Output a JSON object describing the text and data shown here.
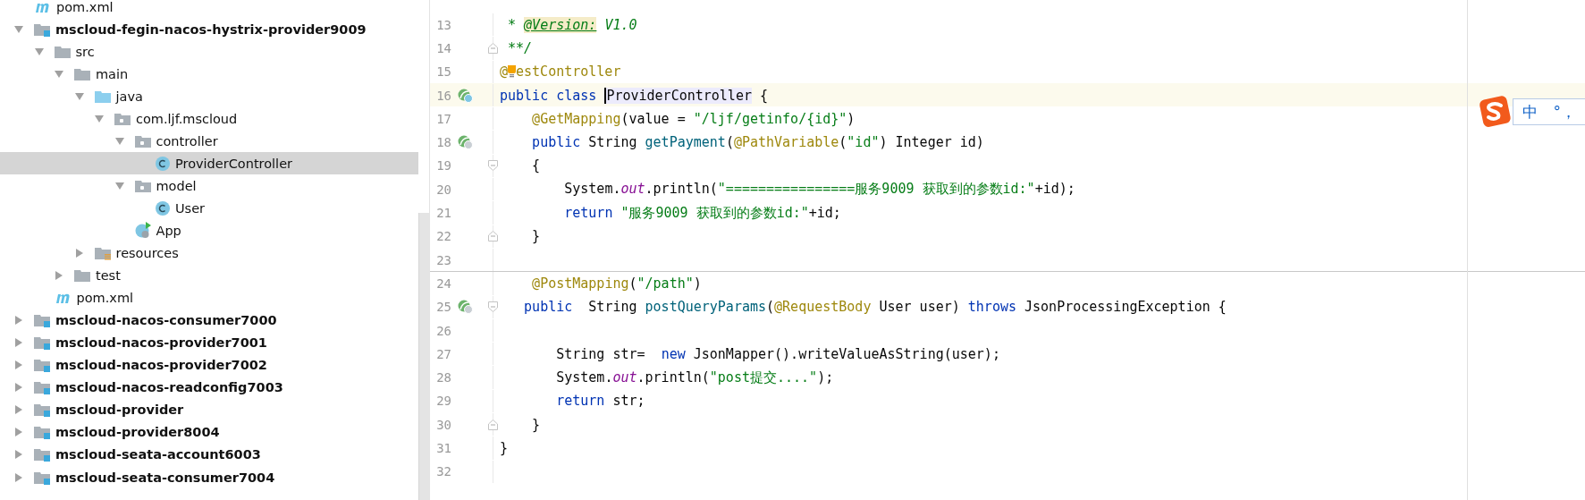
{
  "project_tree": {
    "items": [
      {
        "label": "pom.xml",
        "kind": "maven",
        "selected": false
      },
      {
        "label": "mscloud-fegin-nacos-hystrix-provider9009",
        "kind": "module",
        "expanded": true,
        "selected": false,
        "children": [
          {
            "label": "src",
            "kind": "folder",
            "expanded": true,
            "selected": false,
            "children": [
              {
                "label": "main",
                "kind": "folder",
                "expanded": true,
                "selected": false,
                "children": [
                  {
                    "label": "java",
                    "kind": "source",
                    "expanded": true,
                    "selected": false,
                    "children": [
                      {
                        "label": "com.ljf.mscloud",
                        "kind": "package",
                        "expanded": true,
                        "selected": false,
                        "children": [
                          {
                            "label": "controller",
                            "kind": "package",
                            "expanded": true,
                            "selected": false,
                            "children": [
                              {
                                "label": "ProviderController",
                                "kind": "class",
                                "selected": true
                              }
                            ]
                          },
                          {
                            "label": "model",
                            "kind": "package",
                            "expanded": true,
                            "selected": false,
                            "children": [
                              {
                                "label": "User",
                                "kind": "class",
                                "selected": false
                              }
                            ]
                          },
                          {
                            "label": "App",
                            "kind": "app",
                            "selected": false
                          }
                        ]
                      }
                    ]
                  },
                  {
                    "label": "resources",
                    "kind": "resources",
                    "expanded": false,
                    "selected": false
                  }
                ]
              },
              {
                "label": "test",
                "kind": "folder",
                "expanded": false,
                "selected": false
              }
            ]
          },
          {
            "label": "pom.xml",
            "kind": "maven",
            "selected": false
          }
        ]
      },
      {
        "label": "mscloud-nacos-consumer7000",
        "kind": "module",
        "expanded": false,
        "selected": false
      },
      {
        "label": "mscloud-nacos-provider7001",
        "kind": "module",
        "expanded": false,
        "selected": false
      },
      {
        "label": "mscloud-nacos-provider7002",
        "kind": "module",
        "expanded": false,
        "selected": false
      },
      {
        "label": "mscloud-nacos-readconfig7003",
        "kind": "module",
        "expanded": false,
        "selected": false
      },
      {
        "label": "mscloud-provider",
        "kind": "module",
        "expanded": false,
        "selected": false
      },
      {
        "label": "mscloud-provider8004",
        "kind": "module",
        "expanded": false,
        "selected": false
      },
      {
        "label": "mscloud-seata-account6003",
        "kind": "module",
        "expanded": false,
        "selected": false
      },
      {
        "label": "mscloud-seata-consumer7004",
        "kind": "module",
        "expanded": false,
        "selected": false
      }
    ]
  },
  "editor": {
    "lines": [
      {
        "number": "13",
        "current": false,
        "separator_above": false,
        "segments": [
          {
            "kind": "doc",
            "text": " * "
          },
          {
            "kind": "doctag",
            "text": "@Version:"
          },
          {
            "kind": "doc",
            "text": " V1.0"
          }
        ]
      },
      {
        "number": "14",
        "current": false,
        "separator_above": false,
        "fold": {
          "kind": "end"
        },
        "segments": [
          {
            "kind": "doc",
            "text": " **/"
          }
        ]
      },
      {
        "number": "15",
        "current": false,
        "separator_above": false,
        "segments": [
          {
            "kind": "annotation",
            "text": "@"
          },
          {
            "kind": "bulb"
          },
          {
            "kind": "annotation",
            "text": "estController"
          }
        ]
      },
      {
        "number": "16",
        "current": true,
        "separator_above": false,
        "gutter": {
          "kind": "bean-class"
        },
        "segments": [
          {
            "kind": "keyword",
            "text": "public class "
          },
          {
            "kind": "caret-usage",
            "text": "ProviderController"
          },
          {
            "kind": "plain",
            "text": " {"
          }
        ]
      },
      {
        "number": "17",
        "current": false,
        "separator_above": false,
        "segments": [
          {
            "kind": "annotation",
            "text": "    @GetMapping"
          },
          {
            "kind": "plain",
            "text": "(value = "
          },
          {
            "kind": "string",
            "text": "\"/ljf/getinfo/{id}\""
          },
          {
            "kind": "plain",
            "text": ")"
          }
        ]
      },
      {
        "number": "18",
        "current": false,
        "separator_above": false,
        "gutter": {
          "kind": "bean-method"
        },
        "segments": [
          {
            "kind": "keyword",
            "text": "    public"
          },
          {
            "kind": "plain",
            "text": " String "
          },
          {
            "kind": "method",
            "text": "getPayment"
          },
          {
            "kind": "plain",
            "text": "("
          },
          {
            "kind": "annotation",
            "text": "@PathVariable"
          },
          {
            "kind": "plain",
            "text": "("
          },
          {
            "kind": "string",
            "text": "\"id\""
          },
          {
            "kind": "plain",
            "text": ") Integer id)"
          }
        ]
      },
      {
        "number": "19",
        "current": false,
        "separator_above": false,
        "fold": {
          "kind": "start"
        },
        "segments": [
          {
            "kind": "plain",
            "text": "    {"
          }
        ]
      },
      {
        "number": "20",
        "current": false,
        "separator_above": false,
        "segments": [
          {
            "kind": "plain",
            "text": "        System."
          },
          {
            "kind": "field",
            "text": "out"
          },
          {
            "kind": "plain",
            "text": ".println("
          },
          {
            "kind": "string",
            "text": "\"================服务9009 获取到的参数id:\""
          },
          {
            "kind": "plain",
            "text": "+id);"
          }
        ]
      },
      {
        "number": "21",
        "current": false,
        "separator_above": false,
        "segments": [
          {
            "kind": "keyword",
            "text": "        return "
          },
          {
            "kind": "string",
            "text": "\"服务9009 获取到的参数id:\""
          },
          {
            "kind": "plain",
            "text": "+id;"
          }
        ]
      },
      {
        "number": "22",
        "current": false,
        "separator_above": false,
        "fold": {
          "kind": "end"
        },
        "segments": [
          {
            "kind": "plain",
            "text": "    }"
          }
        ]
      },
      {
        "number": "23",
        "current": false,
        "separator_above": false
      },
      {
        "number": "24",
        "current": false,
        "separator_above": true,
        "segments": [
          {
            "kind": "annotation",
            "text": "    @PostMapping"
          },
          {
            "kind": "plain",
            "text": "("
          },
          {
            "kind": "string",
            "text": "\"/path\""
          },
          {
            "kind": "plain",
            "text": ")"
          }
        ]
      },
      {
        "number": "25",
        "current": false,
        "separator_above": false,
        "gutter": {
          "kind": "bean-method"
        },
        "fold": {
          "kind": "start"
        },
        "segments": [
          {
            "kind": "keyword",
            "text": "   public"
          },
          {
            "kind": "plain",
            "text": "  String "
          },
          {
            "kind": "method",
            "text": "postQueryParams"
          },
          {
            "kind": "plain",
            "text": "("
          },
          {
            "kind": "annotation",
            "text": "@RequestBody"
          },
          {
            "kind": "plain",
            "text": " User user) "
          },
          {
            "kind": "keyword",
            "text": "throws"
          },
          {
            "kind": "plain",
            "text": " JsonProcessingException {"
          }
        ]
      },
      {
        "number": "26",
        "current": false,
        "separator_above": false
      },
      {
        "number": "27",
        "current": false,
        "separator_above": false,
        "segments": [
          {
            "kind": "plain",
            "text": "       String str=  "
          },
          {
            "kind": "keyword",
            "text": "new"
          },
          {
            "kind": "plain",
            "text": " JsonMapper().writeValueAsString(user);"
          }
        ]
      },
      {
        "number": "28",
        "current": false,
        "separator_above": false,
        "segments": [
          {
            "kind": "plain",
            "text": "       System."
          },
          {
            "kind": "field",
            "text": "out"
          },
          {
            "kind": "plain",
            "text": ".println("
          },
          {
            "kind": "string",
            "text": "\"post提交....\""
          },
          {
            "kind": "plain",
            "text": ");"
          }
        ]
      },
      {
        "number": "29",
        "current": false,
        "separator_above": false,
        "segments": [
          {
            "kind": "keyword",
            "text": "       return"
          },
          {
            "kind": "plain",
            "text": " str;"
          }
        ]
      },
      {
        "number": "30",
        "current": false,
        "separator_above": false,
        "fold": {
          "kind": "end"
        },
        "segments": [
          {
            "kind": "plain",
            "text": "    }"
          }
        ]
      },
      {
        "number": "31",
        "current": false,
        "separator_above": false,
        "segments": [
          {
            "kind": "plain",
            "text": "}"
          }
        ]
      },
      {
        "number": "32",
        "current": false,
        "separator_above": false
      }
    ]
  },
  "ime_toolbar": {
    "mode": "中",
    "punctuation": "°，"
  }
}
